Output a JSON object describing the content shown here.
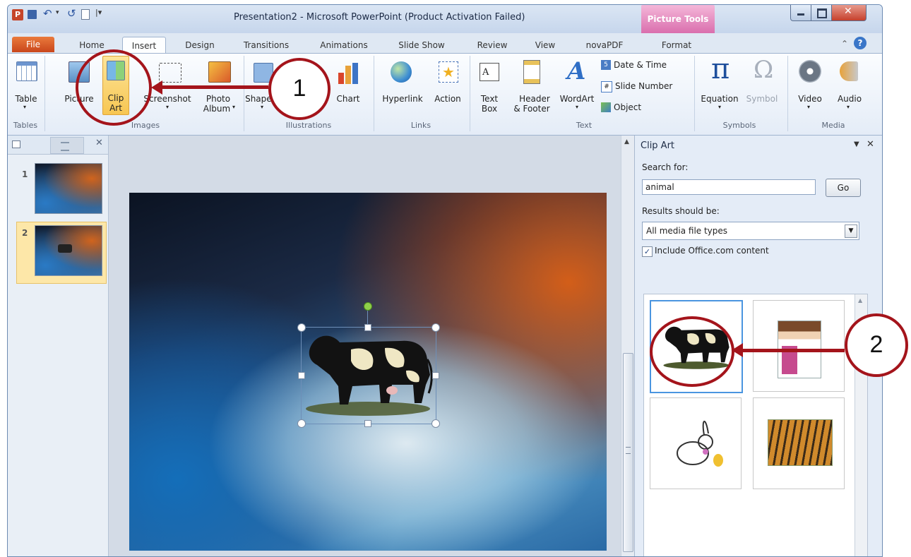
{
  "title": "Presentation2 - Microsoft PowerPoint (Product Activation Failed)",
  "contextual_tab": "Picture Tools",
  "tabs": [
    "File",
    "Home",
    "Insert",
    "Design",
    "Transitions",
    "Animations",
    "Slide Show",
    "Review",
    "View",
    "novaPDF",
    "Format"
  ],
  "ribbon": {
    "table": "Table",
    "picture": "Picture",
    "clip_art_1": "Clip",
    "clip_art_2": "Art",
    "screenshot": "Screenshot",
    "photo_album_1": "Photo",
    "photo_album_2": "Album",
    "shapes": "Shapes",
    "chart": "Chart",
    "hyperlink": "Hyperlink",
    "action": "Action",
    "text_box_1": "Text",
    "text_box_2": "Box",
    "header_footer_1": "Header",
    "header_footer_2": "& Footer",
    "wordart": "WordArt",
    "date_time": "Date & Time",
    "slide_number": "Slide Number",
    "object": "Object",
    "equation": "Equation",
    "symbol": "Symbol",
    "video": "Video",
    "audio": "Audio",
    "groups": {
      "tables": "Tables",
      "images": "Images",
      "illustrations": "Illustrations",
      "links": "Links",
      "text": "Text",
      "symbols": "Symbols",
      "media": "Media"
    }
  },
  "slides": [
    {
      "number": "1"
    },
    {
      "number": "2"
    }
  ],
  "clip_art_pane": {
    "title": "Clip Art",
    "search_label": "Search for:",
    "search_value": "animal",
    "go": "Go",
    "results_label": "Results should be:",
    "results_value": "All media file types",
    "include_label": "Include Office.com content",
    "include_checked": true
  },
  "annotations": [
    "1",
    "2"
  ],
  "colors": {
    "annotation": "#a4141b",
    "file_tab": "#d6562a",
    "picture_tools": "#e07ab6"
  }
}
